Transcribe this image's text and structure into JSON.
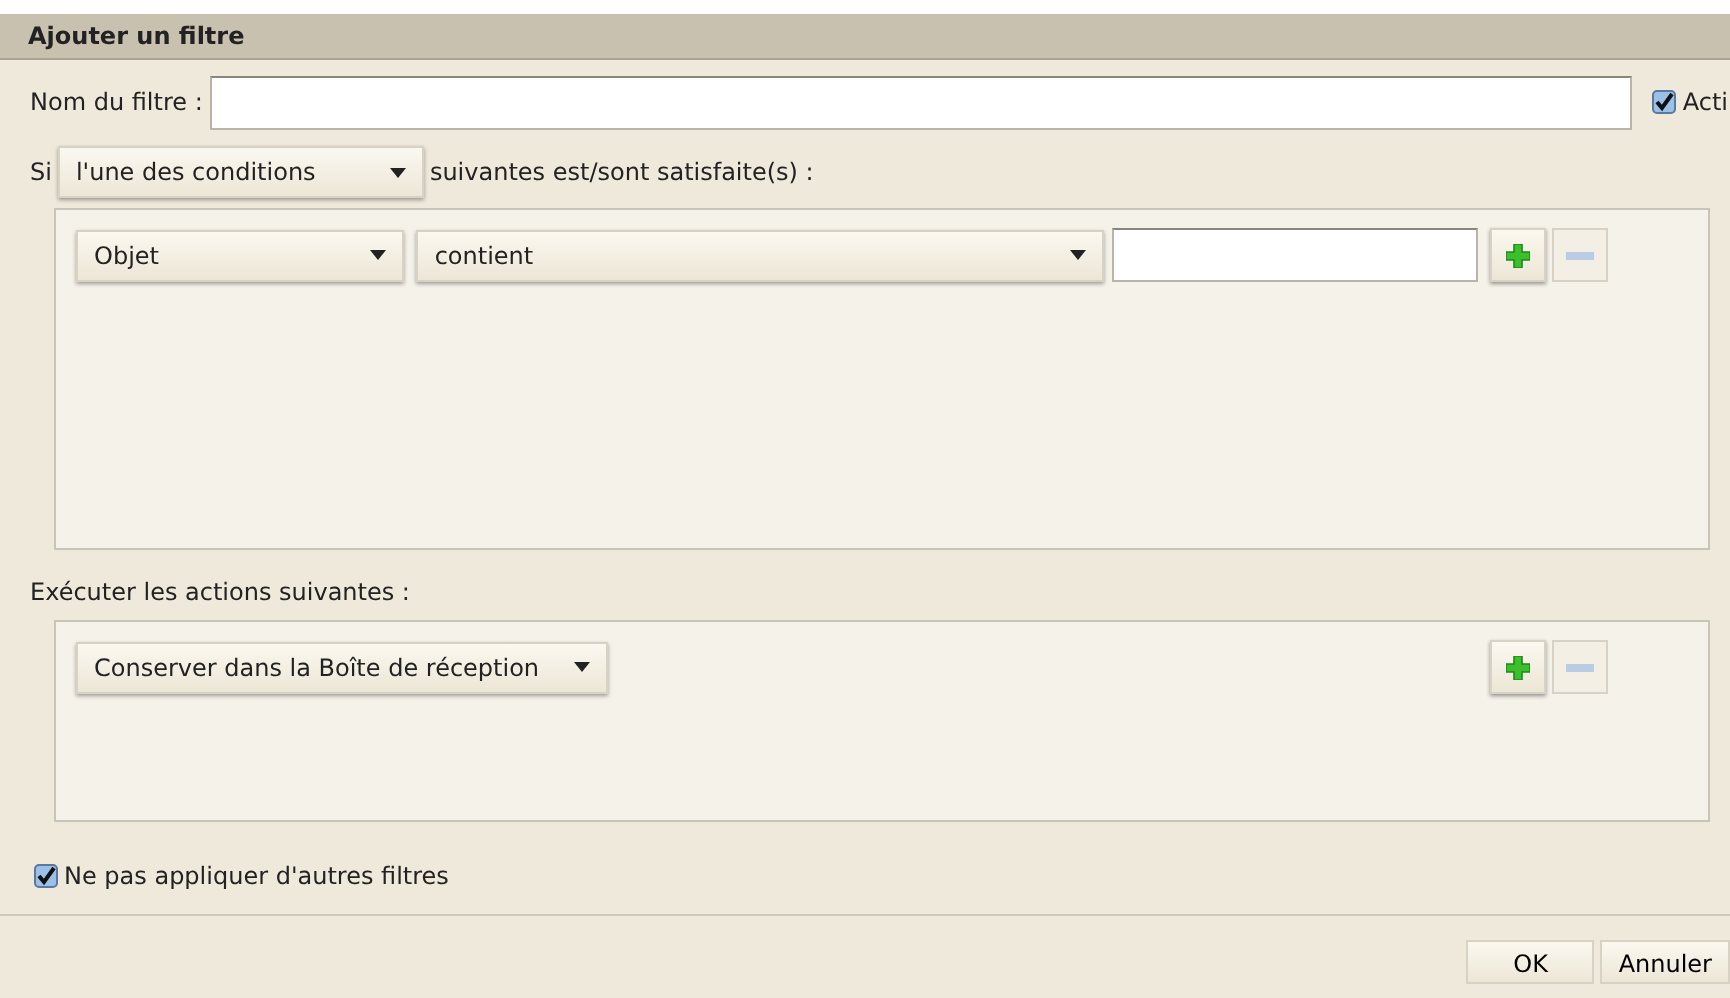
{
  "window": {
    "title": "Ajouter un filtre"
  },
  "filter_name": {
    "label": "Nom du filtre :",
    "active": {
      "label": "Acti",
      "checked": true
    }
  },
  "match": {
    "prefix": "Si",
    "value": "l'une des conditions",
    "suffix": "suivantes est/sont satisfaite(s) :"
  },
  "conditions": [
    {
      "field": "Objet",
      "operator": "contient",
      "add": {
        "disabled": false
      },
      "remove": {
        "disabled": true
      }
    }
  ],
  "actions_label": "Exécuter les actions suivantes :",
  "actions": [
    {
      "action": "Conserver dans la Boîte de réception",
      "add": {
        "disabled": false
      },
      "remove": {
        "disabled": true
      }
    }
  ],
  "stop_filters": {
    "label": "Ne pas appliquer d'autres filtres",
    "checked": true
  },
  "buttons": [
    {
      "label": "OK"
    },
    {
      "label": "Annuler"
    }
  ]
}
